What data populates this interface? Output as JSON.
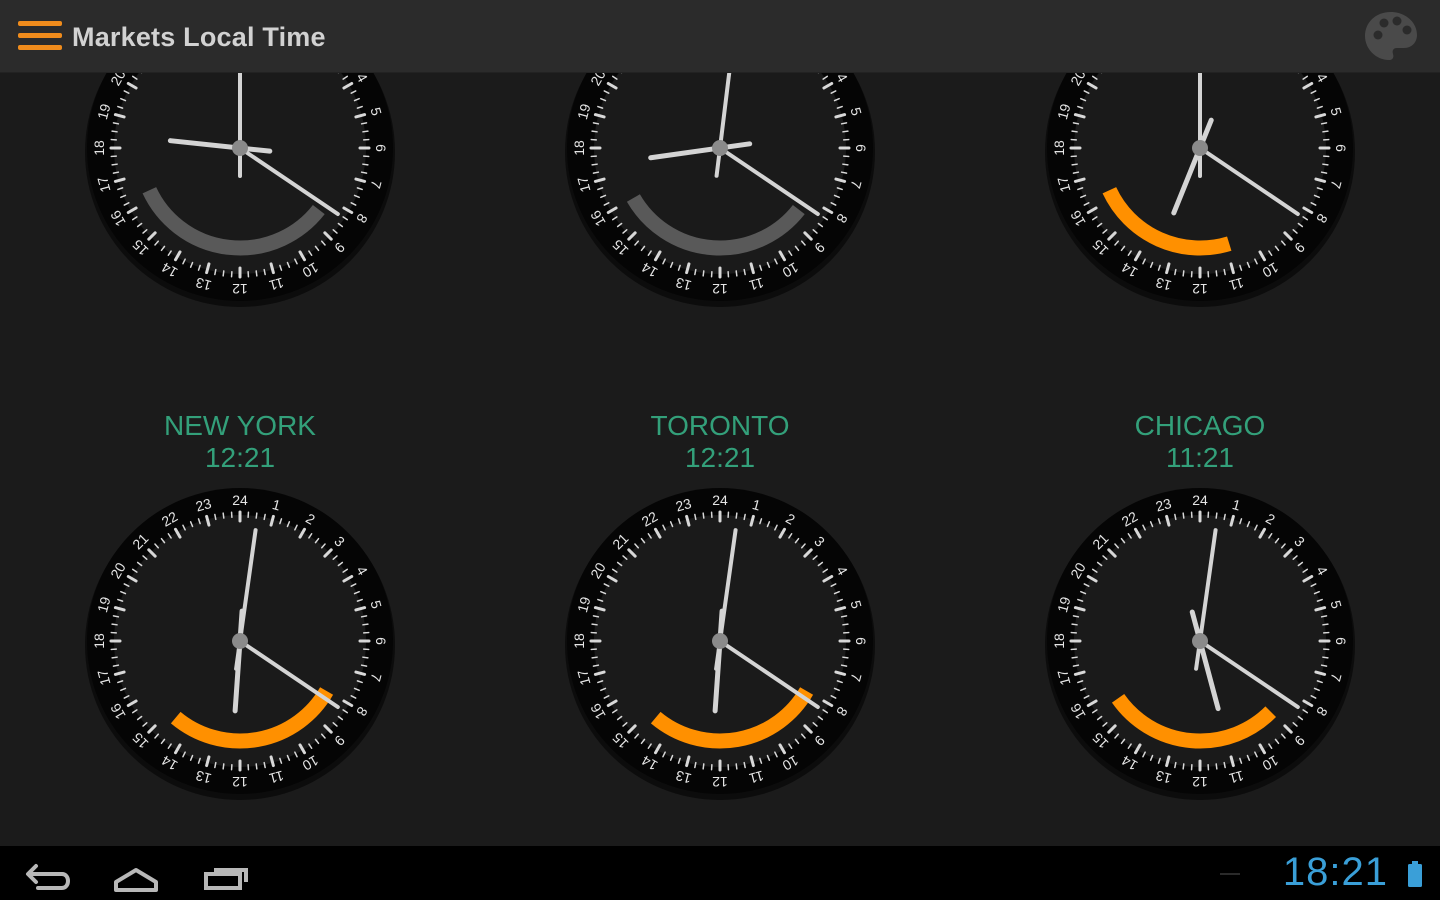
{
  "app": {
    "title": "Markets Local Time",
    "icons": {
      "menu": "menu-icon",
      "palette": "palette-icon"
    }
  },
  "colors": {
    "accent": "#f08c1c",
    "city_label": "#33a07a",
    "market_open_arc": "#ff9000",
    "market_closed_arc": "#595959",
    "status_clock": "#3a9fd8"
  },
  "dial_numbers": [
    "24",
    "1",
    "2",
    "3",
    "4",
    "5",
    "6",
    "7",
    "8",
    "9",
    "10",
    "11",
    "12",
    "13",
    "14",
    "15",
    "16",
    "17",
    "18",
    "19",
    "20",
    "21",
    "22",
    "23"
  ],
  "clocks": [
    {
      "city": "",
      "time": "",
      "hour_hand_deg": 276,
      "minute_hand_deg": 0,
      "second_hand_deg": 124,
      "arc_start_deg": 128,
      "arc_end_deg": 245,
      "market_open": false
    },
    {
      "city": "",
      "time": "",
      "hour_hand_deg": 262,
      "minute_hand_deg": 7,
      "second_hand_deg": 124,
      "arc_start_deg": 128,
      "arc_end_deg": 240,
      "market_open": false
    },
    {
      "city": "",
      "time": "",
      "hour_hand_deg": 202,
      "minute_hand_deg": 0,
      "second_hand_deg": 124,
      "arc_start_deg": 163,
      "arc_end_deg": 245,
      "market_open": true
    },
    {
      "city": "NEW YORK",
      "time": "12:21",
      "hour_hand_deg": 184,
      "minute_hand_deg": 8,
      "second_hand_deg": 124,
      "arc_start_deg": 120,
      "arc_end_deg": 220,
      "market_open": true
    },
    {
      "city": "TORONTO",
      "time": "12:21",
      "hour_hand_deg": 184,
      "minute_hand_deg": 8,
      "second_hand_deg": 124,
      "arc_start_deg": 120,
      "arc_end_deg": 220,
      "market_open": true
    },
    {
      "city": "CHICAGO",
      "time": "11:21",
      "hour_hand_deg": 165,
      "minute_hand_deg": 8,
      "second_hand_deg": 124,
      "arc_start_deg": 135,
      "arc_end_deg": 235,
      "market_open": true
    }
  ],
  "nav": {
    "icons": {
      "back": "back-icon",
      "home": "home-icon",
      "recents": "recent-apps-icon",
      "battery": "battery-icon"
    },
    "time": "18:21"
  }
}
